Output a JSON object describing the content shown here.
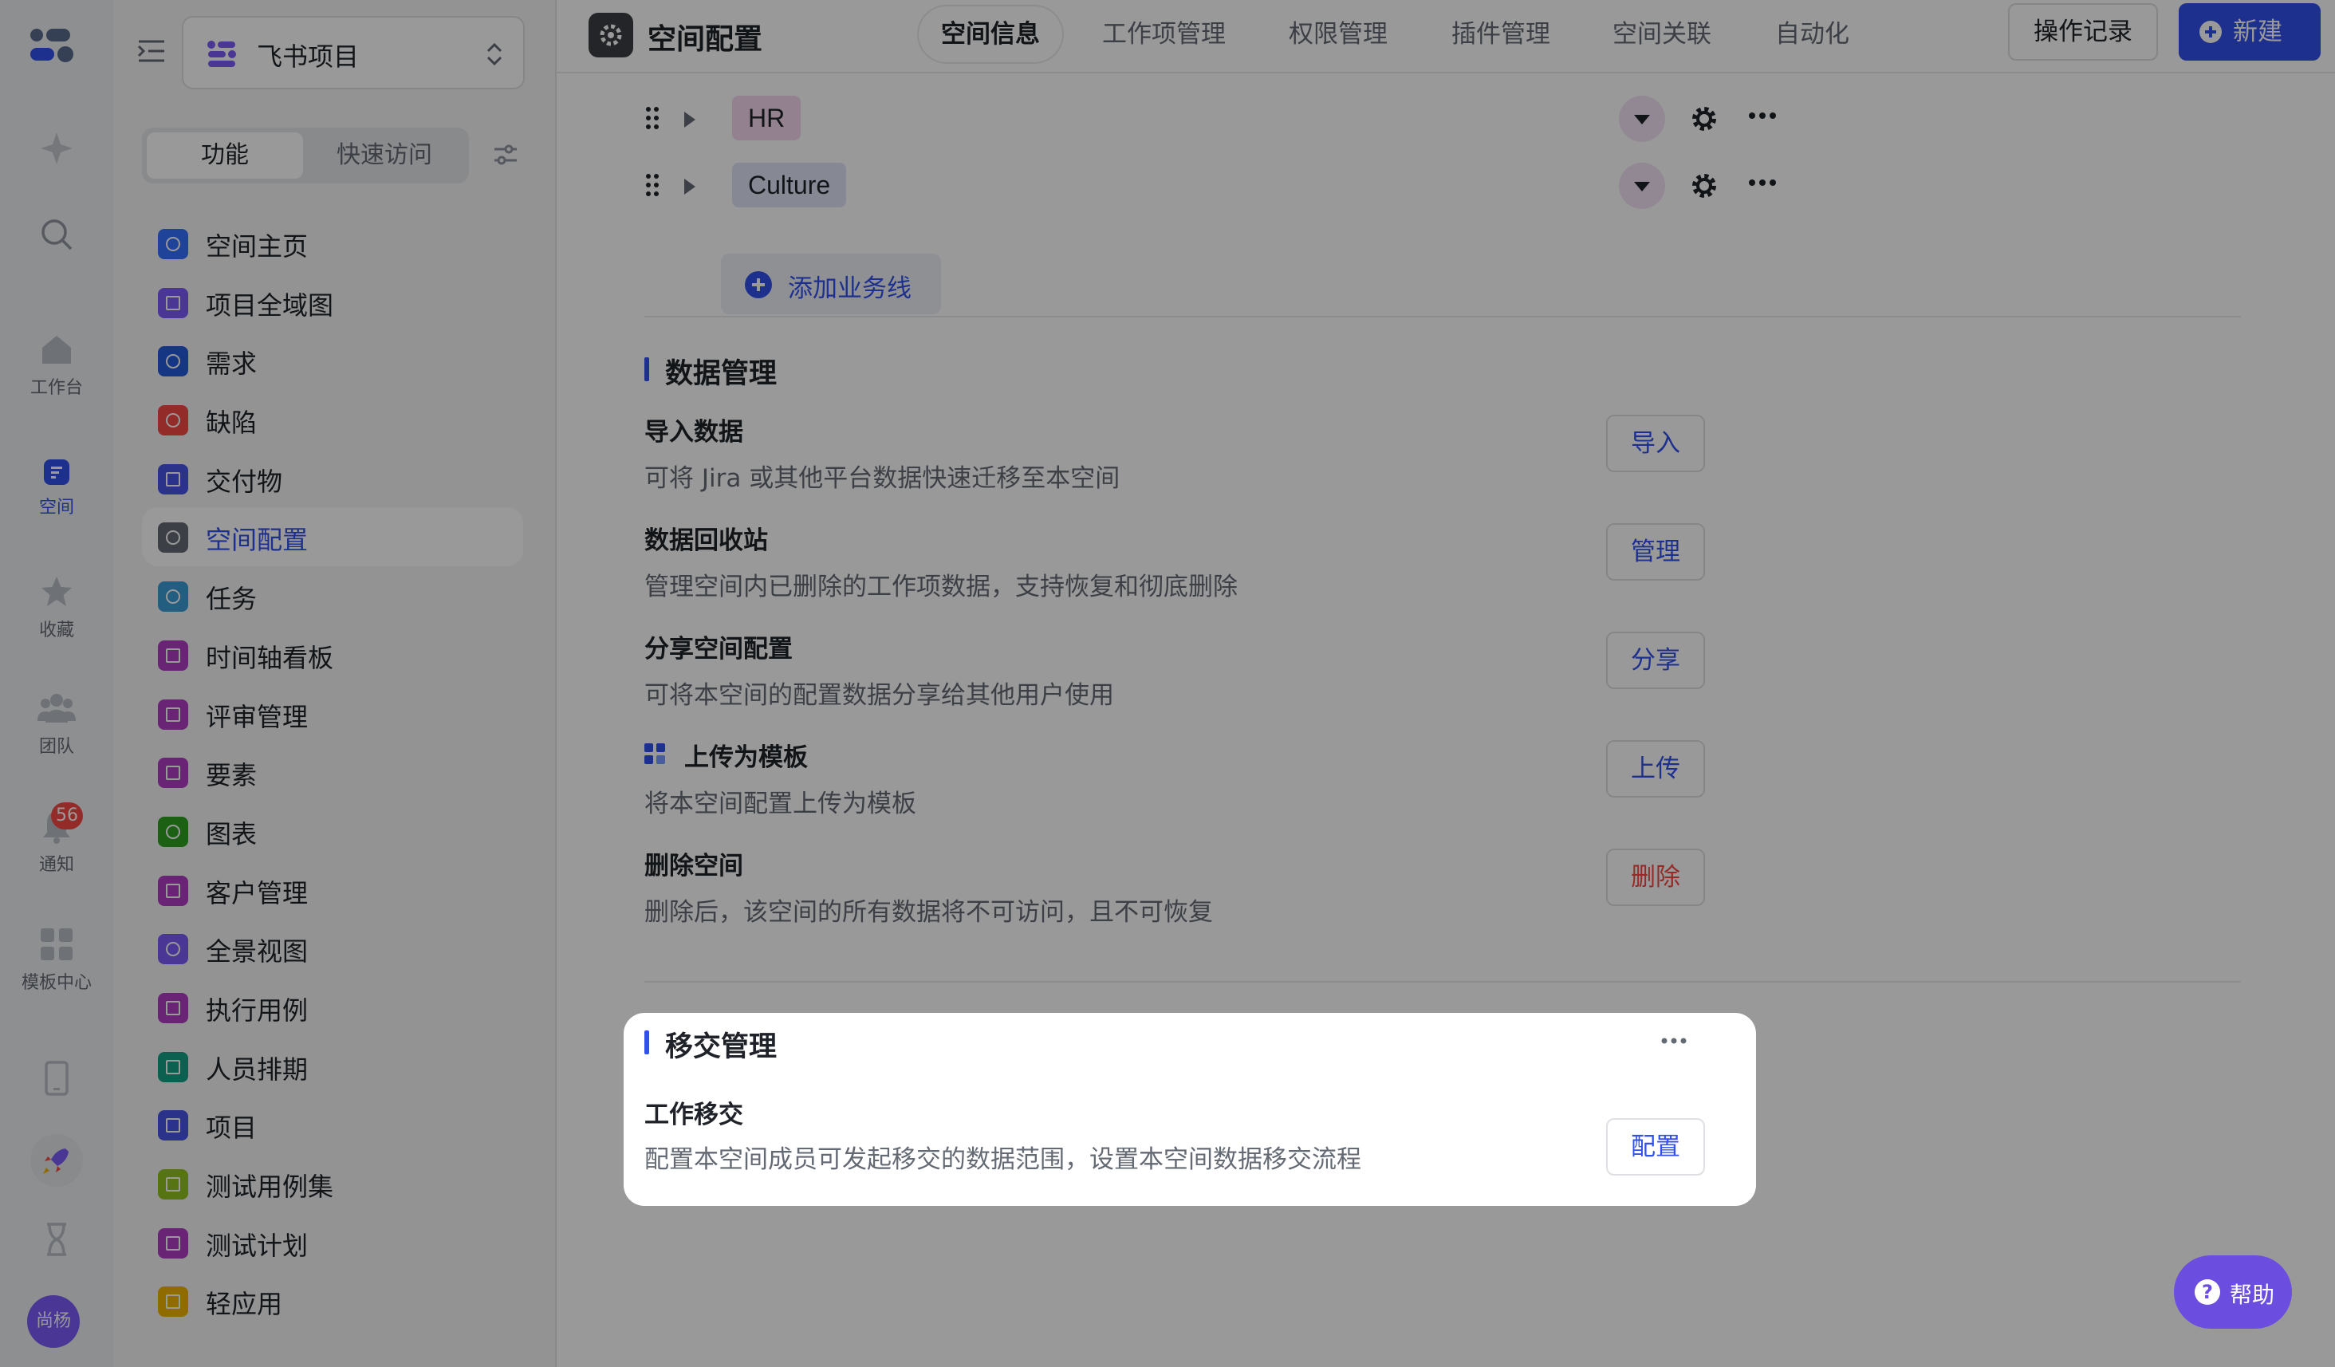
{
  "rail": {
    "items": [
      {
        "icon": "sparkle-icon",
        "label": ""
      },
      {
        "icon": "search-icon",
        "label": ""
      },
      {
        "icon": "home-icon",
        "label": "工作台"
      },
      {
        "icon": "space-icon",
        "label": "空间"
      },
      {
        "icon": "star-icon",
        "label": "收藏"
      },
      {
        "icon": "team-icon",
        "label": "团队"
      },
      {
        "icon": "bell-icon",
        "label": "通知"
      },
      {
        "icon": "grid-icon",
        "label": "模板中心"
      }
    ],
    "notify_badge": "56",
    "avatar_text": "尚杨"
  },
  "sidebar": {
    "project_name": "飞书项目",
    "seg_tabs": [
      "功能",
      "快速访问"
    ],
    "nav": [
      {
        "label": "空间主页",
        "color": "#3370ff"
      },
      {
        "label": "项目全域图",
        "color": "#7a5af8"
      },
      {
        "label": "需求",
        "color": "#245bdb"
      },
      {
        "label": "缺陷",
        "color": "#f54a45"
      },
      {
        "label": "交付物",
        "color": "#4954e6"
      },
      {
        "label": "空间配置",
        "color": "#646a73"
      },
      {
        "label": "任务",
        "color": "#3b9bd6"
      },
      {
        "label": "时间轴看板",
        "color": "#b13dc4"
      },
      {
        "label": "评审管理",
        "color": "#b13dc4"
      },
      {
        "label": "要素",
        "color": "#b13dc4"
      },
      {
        "label": "图表",
        "color": "#2ea121"
      },
      {
        "label": "客户管理",
        "color": "#b13dc4"
      },
      {
        "label": "全景视图",
        "color": "#7a5af8"
      },
      {
        "label": "执行用例",
        "color": "#b13dc4"
      },
      {
        "label": "人员排期",
        "color": "#14a085"
      },
      {
        "label": "项目",
        "color": "#4954e6"
      },
      {
        "label": "测试用例集",
        "color": "#8fc31f"
      },
      {
        "label": "测试计划",
        "color": "#b13dc4"
      },
      {
        "label": "轻应用",
        "color": "#f0b400"
      }
    ]
  },
  "header": {
    "title": "空间配置",
    "tabs": [
      "空间信息",
      "工作项管理",
      "权限管理",
      "插件管理",
      "空间关联",
      "自动化"
    ],
    "active_tab": "空间信息",
    "oplog_label": "操作记录",
    "new_label": "新建"
  },
  "biz": {
    "lines": [
      "HR",
      "Culture"
    ],
    "add_label": "添加业务线"
  },
  "data_mgmt": {
    "title": "数据管理",
    "rows": [
      {
        "title": "导入数据",
        "desc": "可将 Jira 或其他平台数据快速迁移至本空间",
        "btn": "导入"
      },
      {
        "title": "数据回收站",
        "desc": "管理空间内已删除的工作项数据，支持恢复和彻底删除",
        "btn": "管理"
      },
      {
        "title": "分享空间配置",
        "desc": "可将本空间的配置数据分享给其他用户使用",
        "btn": "分享"
      },
      {
        "title": "上传为模板",
        "desc": "将本空间配置上传为模板",
        "btn": "上传"
      },
      {
        "title": "删除空间",
        "desc": "删除后，该空间的所有数据将不可访问，且不可恢复",
        "btn": "删除"
      }
    ]
  },
  "transfer": {
    "title": "移交管理",
    "row_title": "工作移交",
    "row_desc": "配置本空间成员可发起移交的数据范围，设置本空间数据移交流程",
    "btn": "配置"
  },
  "help_label": "帮助"
}
